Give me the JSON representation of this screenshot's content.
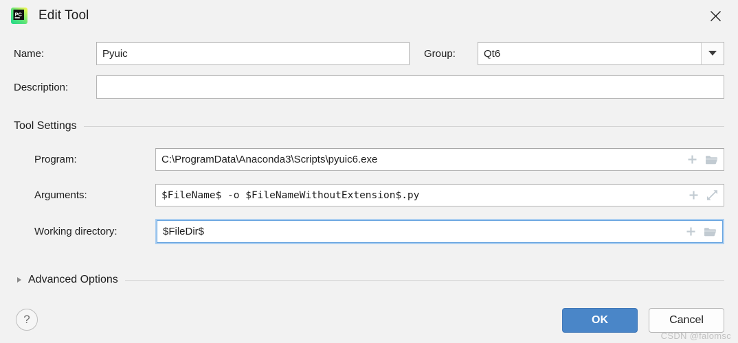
{
  "window": {
    "title": "Edit Tool",
    "app_icon": "pycharm-icon",
    "close_icon": "close-icon"
  },
  "form": {
    "name": {
      "label": "Name:",
      "value": "Pyuic",
      "placeholder": ""
    },
    "group": {
      "label": "Group:",
      "value": "Qt6",
      "dropdown_icon": "chevron-down-icon"
    },
    "description": {
      "label": "Description:",
      "value": "",
      "placeholder": ""
    }
  },
  "tool_settings": {
    "header": "Tool Settings",
    "program": {
      "label": "Program:",
      "value": "C:\\ProgramData\\Anaconda3\\Scripts\\pyuic6.exe",
      "icons": [
        "plus-icon",
        "folder-icon"
      ]
    },
    "arguments": {
      "label": "Arguments:",
      "value": "$FileName$ -o $FileNameWithoutExtension$.py",
      "icons": [
        "plus-icon",
        "expand-icon"
      ]
    },
    "working_directory": {
      "label": "Working directory:",
      "value": "$FileDir$",
      "icons": [
        "plus-icon",
        "folder-icon"
      ],
      "focused": true
    }
  },
  "advanced": {
    "header": "Advanced Options",
    "expanded": false,
    "toggle_icon": "triangle-right-icon"
  },
  "footer": {
    "help_label": "?",
    "ok_label": "OK",
    "cancel_label": "Cancel"
  },
  "watermark": "CSDN @falomsc",
  "colors": {
    "accent": "#4a86c8",
    "focus_ring": "#a9cdf0",
    "dialog_bg": "#f2f2f2"
  }
}
